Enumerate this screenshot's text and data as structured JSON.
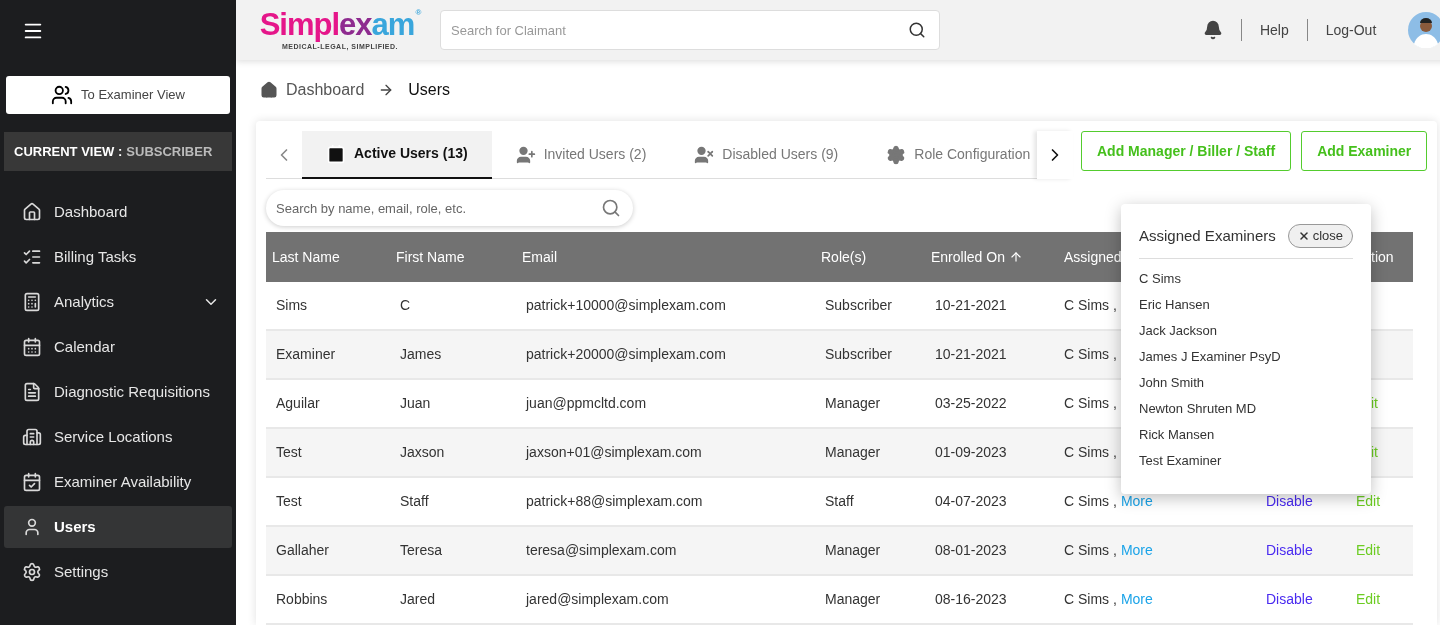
{
  "sidebar": {
    "switch_button": "To Examiner View",
    "current_view": {
      "label": "CURRENT VIEW :",
      "value": "SUBSCRIBER"
    },
    "items": [
      {
        "label": "Dashboard",
        "selected": false
      },
      {
        "label": "Billing Tasks",
        "selected": false
      },
      {
        "label": "Analytics",
        "selected": false,
        "expandable": true
      },
      {
        "label": "Calendar",
        "selected": false
      },
      {
        "label": "Diagnostic Requisitions",
        "selected": false
      },
      {
        "label": "Service Locations",
        "selected": false
      },
      {
        "label": "Examiner Availability",
        "selected": false
      },
      {
        "label": "Users",
        "selected": true
      },
      {
        "label": "Settings",
        "selected": false
      }
    ]
  },
  "header": {
    "logo": {
      "name_parts": [
        "Simpl",
        "ex",
        "am"
      ],
      "mark": "®",
      "tagline": "MEDICAL-LEGAL, SIMPLIFIED."
    },
    "search": {
      "placeholder": "Search for Claimant"
    },
    "links": [
      "Help",
      "Log-Out"
    ]
  },
  "breadcrumb": [
    "Dashboard",
    "Users"
  ],
  "tabs": [
    {
      "label": "Active Users (13)",
      "selected": true
    },
    {
      "label": "Invited Users (2)",
      "selected": false
    },
    {
      "label": "Disabled Users (9)",
      "selected": false
    },
    {
      "label": "Role Configuration",
      "selected": false
    }
  ],
  "actions": [
    "Add Manager / Biller / Staff",
    "Add Examiner"
  ],
  "table_search": {
    "placeholder": "Search by name, email, role, etc."
  },
  "table": {
    "columns": [
      "Last Name",
      "First Name",
      "Email",
      "Role(s)",
      "Enrolled On",
      "Assigned",
      "",
      "tion"
    ],
    "rows": [
      {
        "last": "Sims",
        "first": "C",
        "email": "patrick+10000@simplexam.com",
        "role": "Subscriber",
        "enrolled": "10-21-2021",
        "assigned": "C Sims ,"
      },
      {
        "last": "Examiner",
        "first": "James",
        "email": "patrick+20000@simplexam.com",
        "role": "Subscriber",
        "enrolled": "10-21-2021",
        "assigned": "C Sims ,"
      },
      {
        "last": "Aguilar",
        "first": "Juan",
        "email": "juan@ppmcltd.com",
        "role": "Manager",
        "enrolled": "03-25-2022",
        "assigned": "C Sims ,",
        "edit": "it"
      },
      {
        "last": "Test",
        "first": "Jaxson",
        "email": "jaxson+01@simplexam.com",
        "role": "Manager",
        "enrolled": "01-09-2023",
        "assigned": "C Sims ,",
        "edit": "it"
      },
      {
        "last": "Test",
        "first": "Staff",
        "email": "patrick+88@simplexam.com",
        "role": "Staff",
        "enrolled": "04-07-2023",
        "assigned": "C Sims ,",
        "more": "More",
        "disable": "Disable",
        "edit": "Edit"
      },
      {
        "last": "Gallaher",
        "first": "Teresa",
        "email": "teresa@simplexam.com",
        "role": "Manager",
        "enrolled": "08-01-2023",
        "assigned": "C Sims ,",
        "more": "More",
        "disable": "Disable",
        "edit": "Edit"
      },
      {
        "last": "Robbins",
        "first": "Jared",
        "email": "jared@simplexam.com",
        "role": "Manager",
        "enrolled": "08-16-2023",
        "assigned": "C Sims ,",
        "more": "More",
        "disable": "Disable",
        "edit": "Edit"
      }
    ]
  },
  "popup": {
    "title": "Assigned Examiners",
    "close": "close",
    "names": [
      "C Sims",
      "Eric Hansen",
      "Jack Jackson",
      "James J Examiner PsyD",
      "John Smith",
      "Newton Shruten MD",
      "Rick Mansen",
      "Test Examiner"
    ]
  }
}
